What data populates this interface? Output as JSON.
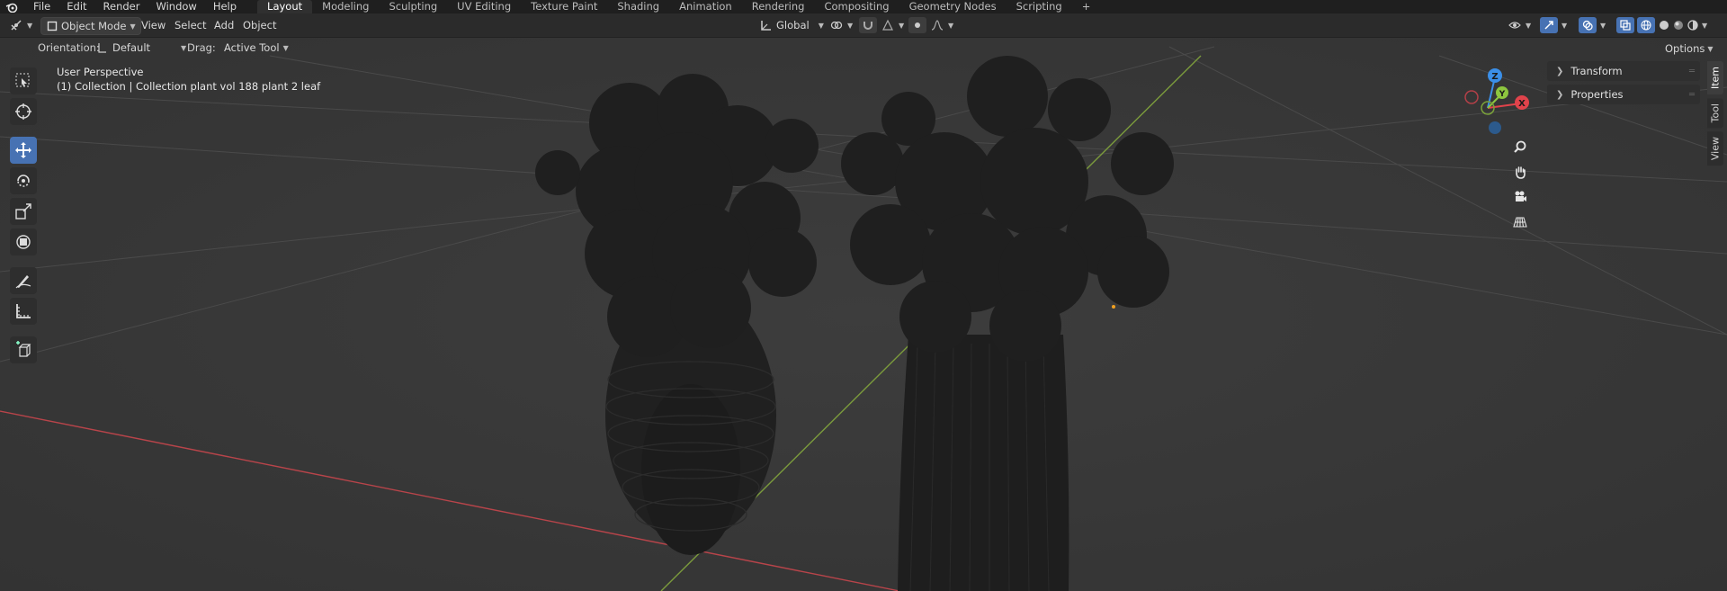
{
  "menubar": {
    "menus": [
      "File",
      "Edit",
      "Render",
      "Window",
      "Help"
    ],
    "workspaces": [
      {
        "label": "Layout",
        "active": true
      },
      {
        "label": "Modeling",
        "active": false
      },
      {
        "label": "Sculpting",
        "active": false
      },
      {
        "label": "UV Editing",
        "active": false
      },
      {
        "label": "Texture Paint",
        "active": false
      },
      {
        "label": "Shading",
        "active": false
      },
      {
        "label": "Animation",
        "active": false
      },
      {
        "label": "Rendering",
        "active": false
      },
      {
        "label": "Compositing",
        "active": false
      },
      {
        "label": "Geometry Nodes",
        "active": false
      },
      {
        "label": "Scripting",
        "active": false
      }
    ],
    "add_workspace": "+"
  },
  "header": {
    "mode": "Object Mode",
    "menus": [
      "View",
      "Select",
      "Add",
      "Object"
    ],
    "transform_orientation": "Global"
  },
  "toolsettings": {
    "orientation_label": "Orientation:",
    "orientation_value": "Default",
    "drag_label": "Drag:",
    "drag_value": "Active Tool",
    "options_label": "Options"
  },
  "viewport": {
    "view_name": "User Perspective",
    "collection_info": "(1) Collection | Collection plant vol 188 plant 2 leaf"
  },
  "gizmo": {
    "x_label": "X",
    "y_label": "Y",
    "z_label": "Z"
  },
  "npanel": {
    "sections": [
      "Transform",
      "Properties"
    ],
    "tabs": [
      "Item",
      "Tool",
      "View"
    ]
  },
  "colors": {
    "accent": "#4772b3",
    "x_axis": "#e0434b",
    "y_axis": "#8dc63f",
    "z_axis": "#3b8fe8",
    "background": "#3a3a3a"
  }
}
